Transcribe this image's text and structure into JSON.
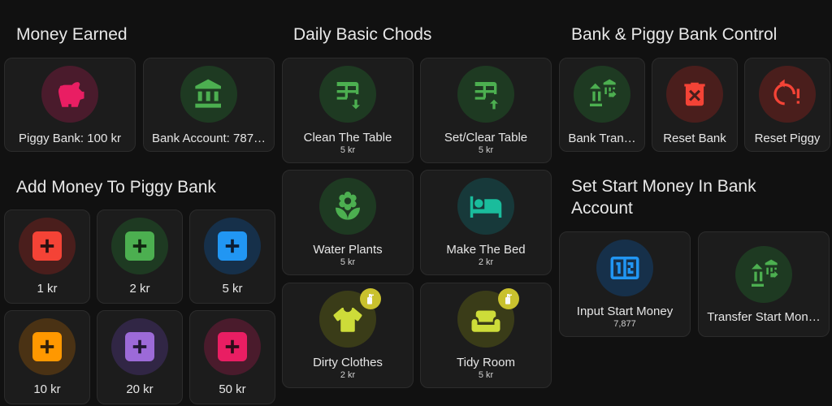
{
  "colors": {
    "background": "#111111",
    "card": "#1c1c1c",
    "pink": "#e91e63",
    "green": "#4caf50",
    "red": "#f44336",
    "blue": "#2196f3",
    "orange": "#ff9800",
    "purple": "#9c6ad8",
    "yellow": "#cddc39",
    "teal": "#1abc9c"
  },
  "sections": {
    "money_earned": "Money Earned",
    "chores": "Daily Basic Chods",
    "bank_control": "Bank & Piggy Bank Control",
    "add_money": "Add Money To Piggy Bank",
    "start_money_line1": "Set Start Money In Bank",
    "start_money_line2": "Account"
  },
  "money_earned": {
    "piggy": {
      "label": "Piggy Bank: 100 kr",
      "icon": "piggy-bank-icon"
    },
    "bank": {
      "label": "Bank Account: 787…",
      "icon": "bank-icon"
    }
  },
  "add_money": [
    {
      "label": "1 kr",
      "color": "#f44336"
    },
    {
      "label": "2 kr",
      "color": "#4caf50"
    },
    {
      "label": "5 kr",
      "color": "#2196f3"
    },
    {
      "label": "10 kr",
      "color": "#ff9800"
    },
    {
      "label": "20 kr",
      "color": "#9c6ad8"
    },
    {
      "label": "50 kr",
      "color": "#e91e63"
    }
  ],
  "chores": [
    {
      "label": "Clean The Table",
      "value": "5 kr",
      "icon": "table-arrow-down-icon"
    },
    {
      "label": "Set/Clear Table",
      "value": "5 kr",
      "icon": "table-arrow-up-icon"
    },
    {
      "label": "Water Plants",
      "value": "5 kr",
      "icon": "flower-icon"
    },
    {
      "label": "Make The Bed",
      "value": "2 kr",
      "icon": "bed-icon"
    },
    {
      "label": "Dirty Clothes",
      "value": "2 kr",
      "icon": "tshirt-icon"
    },
    {
      "label": "Tidy Room",
      "value": "5 kr",
      "icon": "sofa-icon"
    }
  ],
  "bank_control": [
    {
      "label": "Bank Tran…",
      "icon": "bank-transfer-icon"
    },
    {
      "label": "Reset Bank",
      "icon": "trash-x-icon"
    },
    {
      "label": "Reset Piggy",
      "icon": "restart-alert-icon"
    }
  ],
  "start_money": {
    "input": {
      "label": "Input Start Money",
      "value": "7,877",
      "icon": "numeric-input-icon"
    },
    "transfer": {
      "label": "Transfer Start Mon…",
      "icon": "bank-transfer-icon"
    }
  }
}
